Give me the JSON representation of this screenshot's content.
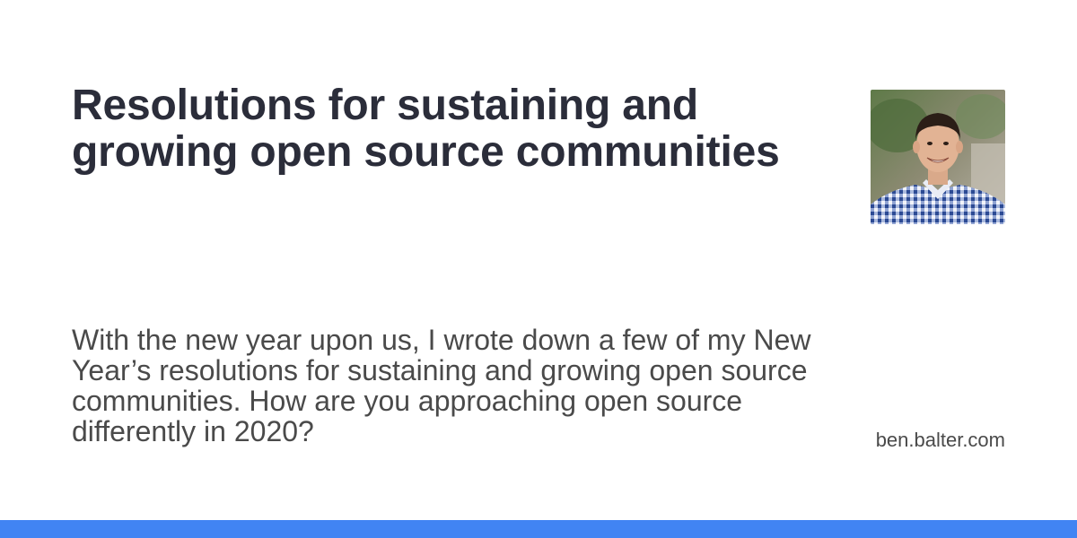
{
  "card": {
    "title": "Resolutions for sustaining and growing open source communities",
    "description": "With the new year upon us, I wrote down a few of my New Year’s resolutions for sustaining and growing open source communities. How are you approaching open source differently in 2020?",
    "site": "ben.balter.com",
    "avatar_icon": "author-photo",
    "accent_color": "#4184f3"
  }
}
